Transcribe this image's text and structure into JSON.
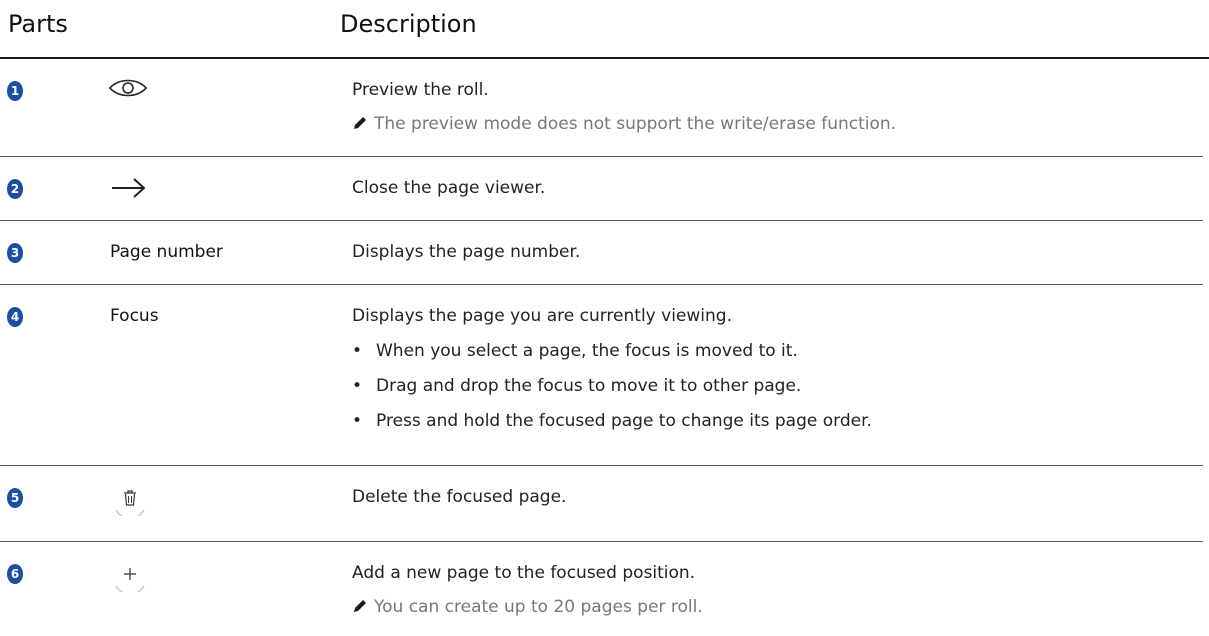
{
  "header": {
    "col_parts": "Parts",
    "col_description": "Description"
  },
  "rows": [
    {
      "number": "1",
      "icon": "eye-icon",
      "description": "Preview the roll.",
      "note": "The preview mode does not support the write/erase function."
    },
    {
      "number": "2",
      "icon": "arrow-right-icon",
      "description": "Close the page viewer."
    },
    {
      "number": "3",
      "part": "Page number",
      "description": "Displays the page number."
    },
    {
      "number": "4",
      "part": "Focus",
      "description": "Displays the page you are currently viewing.",
      "bullets": [
        "When you select a page, the focus is moved to it.",
        "Drag and drop the focus to move it to other page.",
        "Press and hold the focused page to change its page order."
      ]
    },
    {
      "number": "5",
      "icon": "trash-icon",
      "description": "Delete the focused page."
    },
    {
      "number": "6",
      "icon": "plus-icon",
      "description": "Add a new page to the focused position.",
      "note": "You can create up to 20 pages per roll."
    }
  ],
  "colors": {
    "badge": "#1c4ea3",
    "note_text": "#777777",
    "rule": "#1a1a1a"
  }
}
